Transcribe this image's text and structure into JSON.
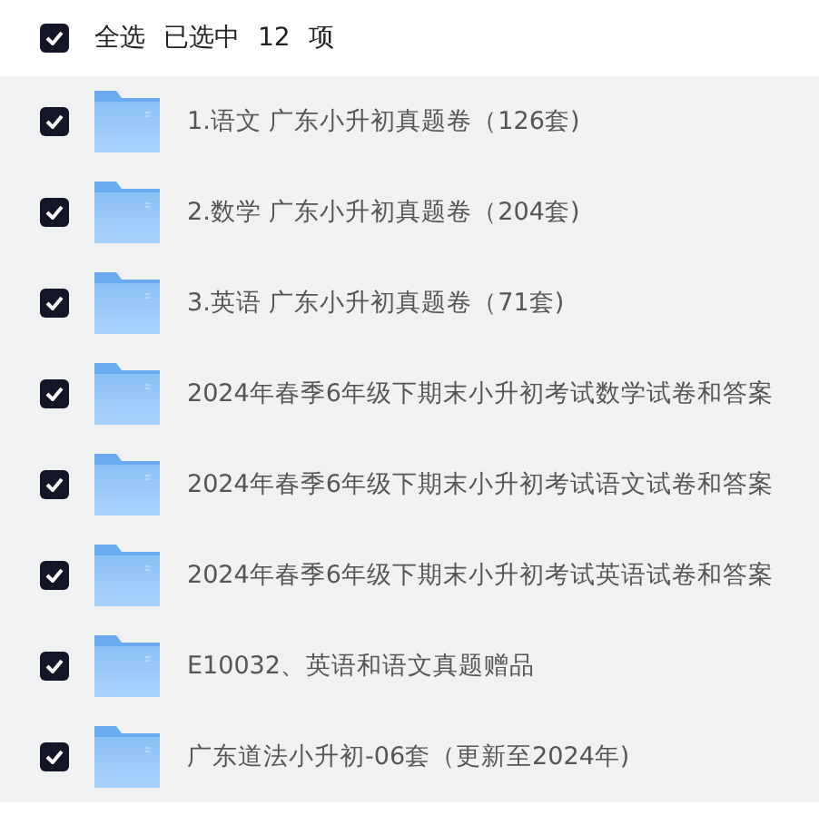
{
  "header": {
    "checked": true,
    "select_all": "全选",
    "selected_label": "已选中",
    "count": "12",
    "unit": "项"
  },
  "items": [
    {
      "name": "1.语文 广东小升初真题卷（126套)",
      "checked": true
    },
    {
      "name": "2.数学 广东小升初真题卷（204套)",
      "checked": true
    },
    {
      "name": "3.英语 广东小升初真题卷（71套)",
      "checked": true
    },
    {
      "name": "2024年春季6年级下期末小升初考试数学试卷和答案",
      "checked": true
    },
    {
      "name": "2024年春季6年级下期末小升初考试语文试卷和答案",
      "checked": true
    },
    {
      "name": "2024年春季6年级下期末小升初考试英语试卷和答案",
      "checked": true
    },
    {
      "name": "E10032、英语和语文真题赠品",
      "checked": true
    },
    {
      "name": "广东道法小升初-06套（更新至2024年)",
      "checked": true
    }
  ]
}
